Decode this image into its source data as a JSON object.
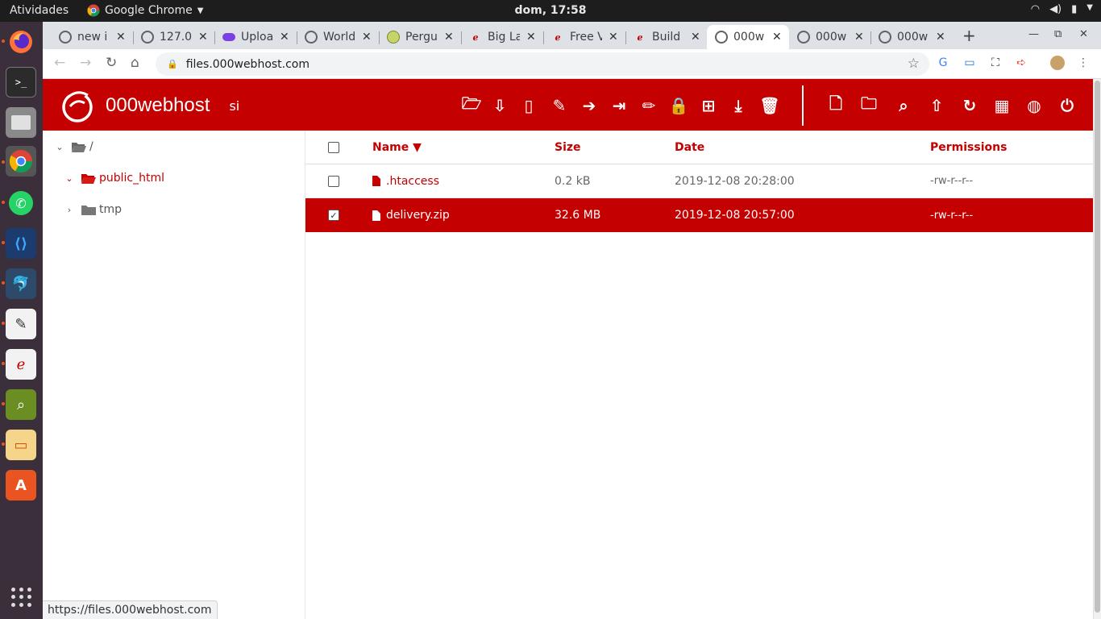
{
  "topbar": {
    "activities": "Atividades",
    "app_name": "Google Chrome",
    "clock": "dom, 17:58"
  },
  "tabs": [
    {
      "label": "new i",
      "icon": "globe-icon"
    },
    {
      "label": "127.0",
      "icon": "globe-icon"
    },
    {
      "label": "Uploa",
      "icon": "cloud-icon"
    },
    {
      "label": "World",
      "icon": "globe-icon"
    },
    {
      "label": "Pergu",
      "icon": "circle-icon"
    },
    {
      "label": "Big La",
      "icon": "webhost-icon"
    },
    {
      "label": "Free V",
      "icon": "webhost-icon"
    },
    {
      "label": "Build",
      "icon": "webhost-icon"
    },
    {
      "label": "000w",
      "icon": "globe-icon",
      "active": true
    },
    {
      "label": "000w",
      "icon": "globe-icon"
    },
    {
      "label": "000w",
      "icon": "globe-icon"
    }
  ],
  "address": {
    "url": "files.000webhost.com"
  },
  "app": {
    "brand": "000webhost",
    "site_label": "si",
    "accent": "#c40000"
  },
  "tree": {
    "root": "/",
    "items": [
      {
        "label": "public_html",
        "expanded": true
      },
      {
        "label": "tmp",
        "expanded": false
      }
    ]
  },
  "table": {
    "headers": {
      "name": "Name ▼",
      "size": "Size",
      "date": "Date",
      "permissions": "Permissions"
    },
    "rows": [
      {
        "name": ".htaccess",
        "size": "0.2 kB",
        "date": "2019-12-08 20:28:00",
        "permissions": "-rw-r--r--",
        "selected": false
      },
      {
        "name": "delivery.zip",
        "size": "32.6 MB",
        "date": "2019-12-08 20:57:00",
        "permissions": "-rw-r--r--",
        "selected": true
      }
    ]
  },
  "status_url": "https://files.000webhost.com"
}
